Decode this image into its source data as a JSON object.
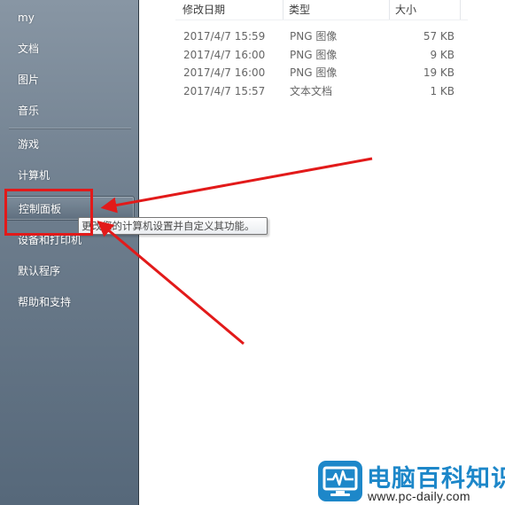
{
  "start_menu": {
    "items": [
      {
        "label": "my"
      },
      {
        "label": "文档"
      },
      {
        "label": "图片"
      },
      {
        "label": "音乐"
      },
      {
        "label": "游戏"
      },
      {
        "label": "计算机"
      },
      {
        "label": "控制面板"
      },
      {
        "label": "设备和打印机"
      },
      {
        "label": "默认程序"
      },
      {
        "label": "帮助和支持"
      }
    ],
    "tooltip": "更改您的计算机设置并自定义其功能。"
  },
  "file_list": {
    "columns": [
      "修改日期",
      "类型",
      "大小"
    ],
    "rows": [
      {
        "date": "2017/4/7 15:59",
        "type": "PNG 图像",
        "size": "57 KB"
      },
      {
        "date": "2017/4/7 16:00",
        "type": "PNG 图像",
        "size": "9 KB"
      },
      {
        "date": "2017/4/7 16:00",
        "type": "PNG 图像",
        "size": "19 KB"
      },
      {
        "date": "2017/4/7 15:57",
        "type": "文本文档",
        "size": "1 KB"
      }
    ]
  },
  "annotation_color": "#e21a1a",
  "watermark": {
    "title": "电脑百科知识",
    "url": "www.pc-daily.com",
    "logo_color": "#1d87c9"
  }
}
